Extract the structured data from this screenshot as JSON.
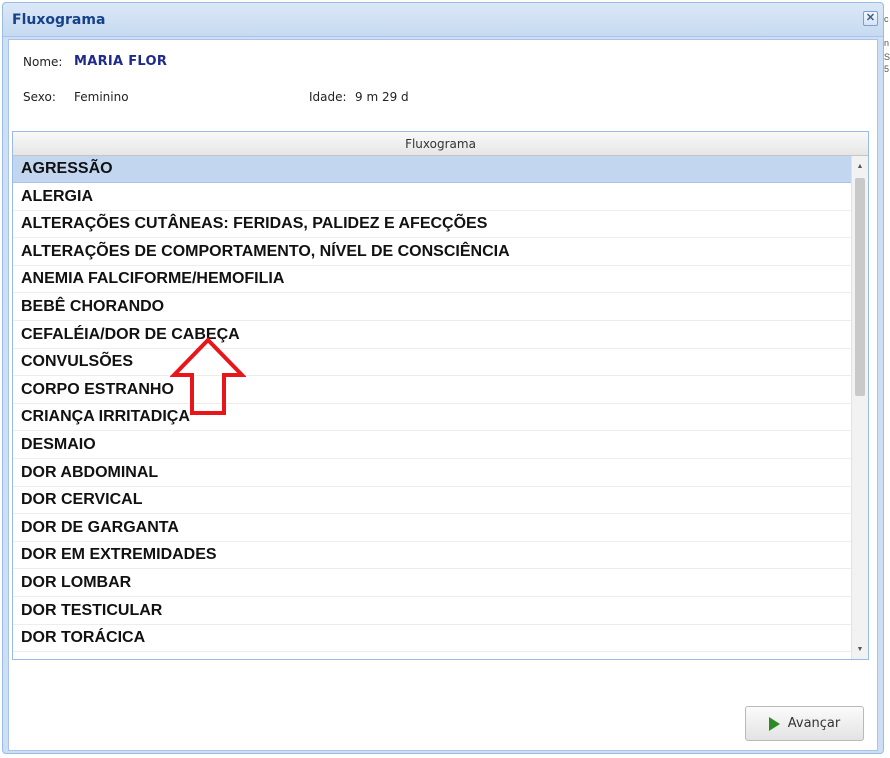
{
  "window": {
    "title": "Fluxograma",
    "close_glyph": "✕"
  },
  "patient": {
    "name_label": "Nome:",
    "name_value": "MARIA FLOR",
    "sex_label": "Sexo:",
    "sex_value": "Feminino",
    "age_label": "Idade:",
    "age_value": "9 m 29 d"
  },
  "grid": {
    "header": "Fluxograma",
    "selected_index": 0,
    "items": [
      "AGRESSÃO",
      "ALERGIA",
      "ALTERAÇÕES CUTÂNEAS: FERIDAS, PALIDEZ E AFECÇÕES",
      "ALTERAÇÕES DE COMPORTAMENTO, NÍVEL DE CONSCIÊNCIA",
      "ANEMIA FALCIFORME/HEMOFILIA",
      "BEBÊ CHORANDO",
      "CEFALÉIA/DOR DE CABEÇA",
      "CONVULSÕES",
      "CORPO ESTRANHO",
      "CRIANÇA IRRITADIÇA",
      "DESMAIO",
      "DOR ABDOMINAL",
      "DOR CERVICAL",
      "DOR DE GARGANTA",
      "DOR EM EXTREMIDADES",
      "DOR LOMBAR",
      "DOR TESTICULAR",
      "DOR TORÁCICA"
    ],
    "scroll_up_glyph": "▲",
    "scroll_down_glyph": "▼"
  },
  "footer": {
    "advance_label": "Avançar",
    "advance_icon": "play-icon"
  },
  "annotation": {
    "arrow_color": "#e8151b",
    "icon": "red-up-arrow-icon"
  },
  "edge_glyphs": [
    "c",
    "n",
    "S",
    "5"
  ]
}
